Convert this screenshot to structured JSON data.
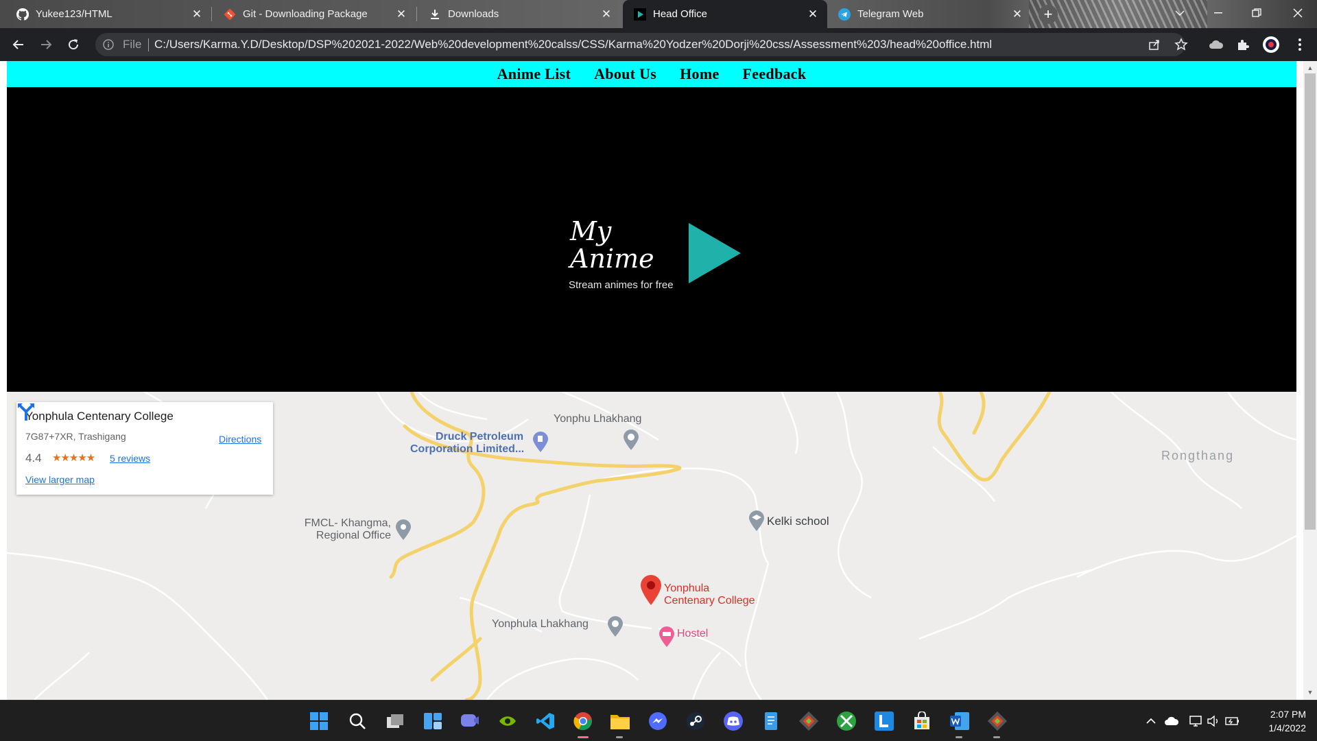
{
  "browser": {
    "tabs": [
      {
        "title": "Yukee123/HTML",
        "icon": "github-icon"
      },
      {
        "title": "Git - Downloading Package",
        "icon": "git-icon"
      },
      {
        "title": "Downloads",
        "icon": "download-icon"
      },
      {
        "title": "Head Office",
        "icon": "play-favicon",
        "active": true
      },
      {
        "title": "Telegram Web",
        "icon": "telegram-icon"
      }
    ],
    "address": {
      "scheme_label": "File",
      "url": "C:/Users/Karma.Y.D/Desktop/DSP%202021-2022/Web%20development%20calss/CSS/Karma%20Yodzer%20Dorji%20css/Assessment%203/head%20office.html"
    }
  },
  "page": {
    "nav": [
      "Anime List",
      "About Us",
      "Home",
      "Feedback"
    ],
    "nav_bg": "#00ffff",
    "hero": {
      "logo_line1": "My",
      "logo_line2": "Anime",
      "tagline": "Stream animes for free",
      "play_color": "#20b2aa"
    },
    "map": {
      "place_card": {
        "name": "Yonphula Centenary College",
        "address": "7G87+7XR, Trashigang",
        "rating": "4.4",
        "stars": "★★★★★",
        "reviews": "5 reviews",
        "larger_map": "View larger map",
        "directions": "Directions"
      },
      "labels": {
        "yonphu_lhakhang": "Yonphu Lhakhang",
        "druck_1": "Druck Petroleum",
        "druck_2": "Corporation Limited...",
        "rongthang": "Rongthang",
        "fmcl_1": "FMCL- Khangma,",
        "fmcl_2": "Regional Office",
        "kelki": "Kelki school",
        "college_1": "Yonphula",
        "college_2": "Centenary College",
        "yonphula_lhakhang": "Yonphula Lhakhang",
        "hostel": "Hostel"
      }
    }
  },
  "taskbar": {
    "apps": [
      "windows-start-icon",
      "search-icon",
      "task-view-icon",
      "widgets-icon",
      "teams-chat-icon",
      "nvidia-icon",
      "vscode-icon",
      "chrome-icon",
      "file-explorer-icon",
      "messenger-icon",
      "steam-icon",
      "discord-icon",
      "notepad-icon",
      "git-icon",
      "xbox-icon",
      "l-app-icon",
      "store-icon",
      "word-icon",
      "git-gui-icon"
    ],
    "time": "2:07 PM",
    "date": "1/4/2022"
  }
}
